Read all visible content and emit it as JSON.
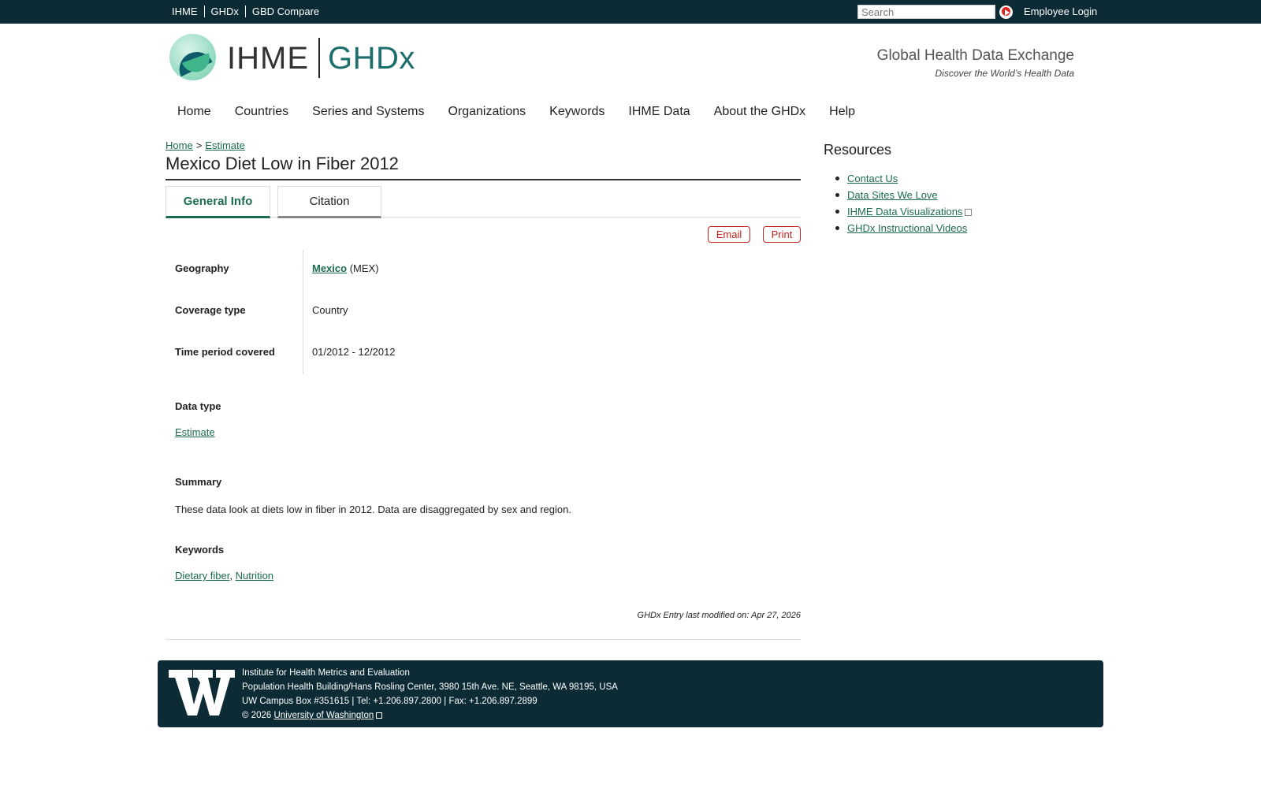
{
  "topbar": {
    "links": [
      "IHME",
      "GHDx",
      "GBD Compare"
    ],
    "search_placeholder": "Search",
    "login_label": "Employee Login"
  },
  "header": {
    "logo_ihme": "IHME",
    "logo_ghdx": "GHDx",
    "tagline": "Global Health Data Exchange",
    "subtagline": "Discover the World’s Health Data"
  },
  "nav": [
    "Home",
    "Countries",
    "Series and Systems",
    "Organizations",
    "Keywords",
    "IHME Data",
    "About the GHDx",
    "Help"
  ],
  "breadcrumb": {
    "home": "Home",
    "sep": ">",
    "current": "Estimate"
  },
  "page_title": "Mexico Diet Low in Fiber 2012",
  "tabs": {
    "general": "General Info",
    "citation": "Citation"
  },
  "actions": {
    "email": "Email",
    "print": "Print"
  },
  "fields": {
    "geography_label": "Geography",
    "geography_link": "Mexico",
    "geography_code": "(MEX)",
    "coverage_label": "Coverage type",
    "coverage_value": "Country",
    "time_label": "Time period covered",
    "time_value": "01/2012 - 12/2012"
  },
  "data_type": {
    "label": "Data type",
    "value": "Estimate"
  },
  "summary": {
    "label": "Summary",
    "text": "These data look at diets low in fiber in 2012. Data are disaggregated by sex and region."
  },
  "keywords": {
    "label": "Keywords",
    "items": [
      "Dietary fiber",
      "Nutrition"
    ],
    "separator": ","
  },
  "modified": "GHDx Entry last modified on: Apr 27, 2026",
  "sidebar": {
    "title": "Resources",
    "links": [
      "Contact Us",
      "Data Sites We Love",
      "IHME Data Visualizations",
      "GHDx Instructional Videos"
    ]
  },
  "footer": {
    "line1": "Institute for Health Metrics and Evaluation",
    "line2": "Population Health Building/Hans Rosling Center, 3980 15th Ave. NE, Seattle, WA 98195, USA",
    "line3": "UW Campus Box #351615 | Tel: +1.206.897.2800 | Fax: +1.206.897.2899",
    "copyright": "© 2026",
    "uw_link": "University of Washington"
  },
  "colors": {
    "topbar": "#0d2b35",
    "link": "#1b6b50",
    "accent_red": "#c0241b"
  }
}
